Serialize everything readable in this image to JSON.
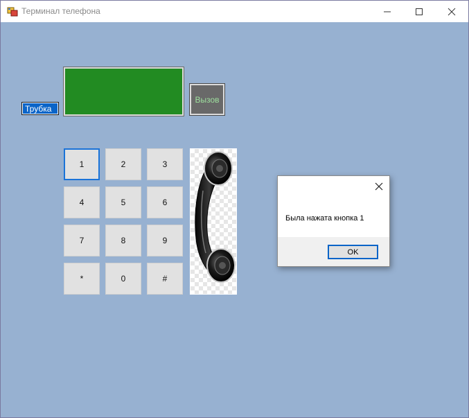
{
  "window": {
    "title": "Терминал телефона",
    "controls": [
      "minimize-icon",
      "maximize-icon",
      "close-icon"
    ]
  },
  "form": {
    "tube_label": "Трубка",
    "display_value": "",
    "call_button": "Вызов",
    "keypad": [
      [
        "1",
        "2",
        "3"
      ],
      [
        "4",
        "5",
        "6"
      ],
      [
        "7",
        "8",
        "9"
      ],
      [
        "*",
        "0",
        "#"
      ]
    ],
    "focused_key": "1",
    "colors": {
      "background": "#97b1d1",
      "display": "#228b22",
      "call_button_bg": "#696969",
      "call_button_text": "#9ee09e",
      "tube_label_bg": "#0a64c8"
    },
    "image": "telephone-handset"
  },
  "dialog": {
    "message": "Была нажата кнопка 1",
    "ok_label": "OK"
  }
}
